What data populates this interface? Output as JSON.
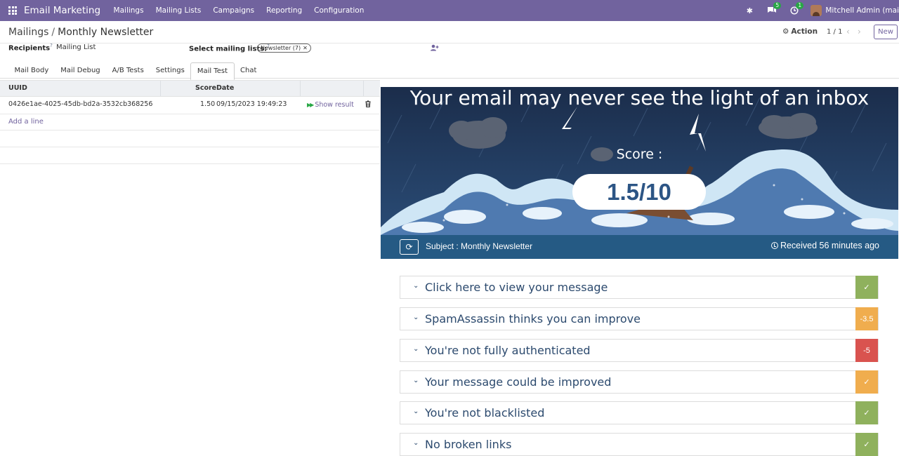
{
  "nav": {
    "app_name": "Email Marketing",
    "menu": [
      "Mailings",
      "Mailing Lists",
      "Campaigns",
      "Reporting",
      "Configuration"
    ],
    "chat_count": "5",
    "activity_count": "1",
    "user_name": "Mitchell Admin (mai"
  },
  "control_panel": {
    "breadcrumb_parent": "Mailings",
    "breadcrumb_separator": "/",
    "breadcrumb_current": "Monthly Newsletter",
    "action_label": "Action",
    "pager": "1 / 1",
    "new_label": "New"
  },
  "form": {
    "recipients_label": "Recipients",
    "recipients_help": "?",
    "recipients_value": "Mailing List",
    "lists_label": "Select mailing lists:",
    "lists_help": "?",
    "list_tag": "Newsletter (7)"
  },
  "tabs": [
    "Mail Body",
    "Mail Debug",
    "A/B Tests",
    "Settings",
    "Mail Test",
    "Chat"
  ],
  "table": {
    "columns": {
      "uuid": "UUID",
      "score": "Score",
      "date": "Date"
    },
    "rows": [
      {
        "uuid": "0426e1ae-4025-45db-bd2a-3532cb368256",
        "score": "1.50",
        "date": "09/15/2023 19:49:23",
        "action": "Show result"
      }
    ],
    "add_line": "Add a line"
  },
  "result_panel": {
    "headline": "Your email may never see the light of an inbox",
    "score_label": "Score :",
    "score_value": "1.5/10",
    "subject": "Subject : Monthly Newsletter",
    "received": "Received 56 minutes ago",
    "checks": [
      {
        "label": "Click here to view your message",
        "badge": "✓",
        "color": "#8fb15d"
      },
      {
        "label": "SpamAssassin thinks you can improve",
        "badge": "-3.5",
        "color": "#f0ad4e"
      },
      {
        "label": "You're not fully authenticated",
        "badge": "-5",
        "color": "#d9534f"
      },
      {
        "label": "Your message could be improved",
        "badge": "✓",
        "color": "#f0ad4e"
      },
      {
        "label": "You're not blacklisted",
        "badge": "✓",
        "color": "#8fb15d"
      },
      {
        "label": "No broken links",
        "badge": "✓",
        "color": "#8fb15d"
      }
    ]
  }
}
